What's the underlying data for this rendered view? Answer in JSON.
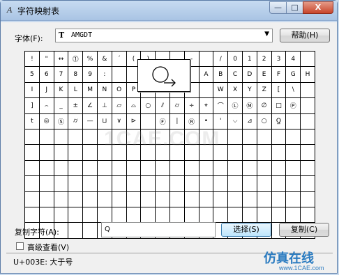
{
  "window": {
    "title": "字符映射表",
    "controls": {
      "minimize": "—",
      "maximize": "□",
      "close": "X"
    }
  },
  "font_row": {
    "label": "字体(F):",
    "selected_font": "AMGDT",
    "font_type_icon": "truetype-icon",
    "help_button": "帮助(H)"
  },
  "grid": {
    "cells": [
      "!",
      "\"",
      "↔",
      "⓵",
      "%",
      "&",
      "´",
      "(",
      ")",
      "",
      "",
      "-",
      "",
      "/",
      "0",
      "1",
      "2",
      "3",
      "4",
      "",
      "5",
      "6",
      "7",
      "8",
      "9",
      ":",
      "",
      "",
      "",
      "",
      "",
      "",
      "A",
      "B",
      "C",
      "D",
      "E",
      "F",
      "G",
      "H",
      "I",
      "J",
      "K",
      "L",
      "M",
      "N",
      "O",
      "P",
      "Q",
      "",
      "",
      "",
      "",
      "W",
      "X",
      "Y",
      "Z",
      "[",
      "\\",
      "",
      "]",
      "⌢",
      "_",
      "±",
      "∠",
      "⊥",
      "▱",
      "⌓",
      "○",
      "⫽",
      "⌭",
      "÷",
      "⌖",
      "⌒",
      "Ⓛ",
      "Ⓜ",
      "∅",
      "□",
      "Ⓟ",
      "",
      "t",
      "◎",
      "Ⓢ",
      "⌭",
      "—",
      "⊔",
      "∨",
      "⊳",
      "",
      "Ⓕ",
      "|",
      "Ⓡ",
      "•",
      "'",
      "⌵",
      "⊿",
      "○",
      "Q̲",
      "",
      ""
    ],
    "rows": 12
  },
  "copy_row": {
    "label": "复制字符(A):",
    "value": "Q",
    "select_button": "选择(S)",
    "copy_button": "复制(C)"
  },
  "advanced": {
    "label": "高级查看(V)"
  },
  "status": {
    "text": "U+003E: 大于号"
  },
  "branding": {
    "watermark": "1CAE.COM",
    "logo": "仿真在线",
    "url": "www.1CAE.com"
  }
}
